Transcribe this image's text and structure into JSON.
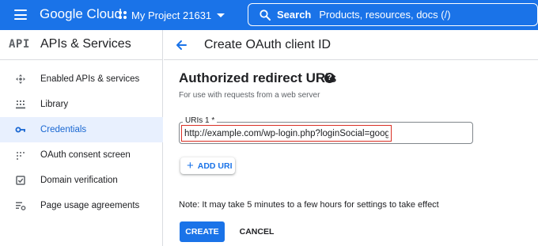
{
  "topbar": {
    "app_name": "Google Cloud",
    "project_name": "My Project 21631",
    "search_label": "Search",
    "search_placeholder": "Products, resources, docs (/)",
    "color": "#1a73e8"
  },
  "sidebar": {
    "badge": "API",
    "title": "APIs & Services",
    "items": [
      {
        "label": "Enabled APIs & services",
        "icon": "enabled-apis-icon",
        "active": false
      },
      {
        "label": "Library",
        "icon": "library-icon",
        "active": false
      },
      {
        "label": "Credentials",
        "icon": "key-icon",
        "active": true
      },
      {
        "label": "OAuth consent screen",
        "icon": "consent-screen-icon",
        "active": false
      },
      {
        "label": "Domain verification",
        "icon": "checkbox-icon",
        "active": false
      },
      {
        "label": "Page usage agreements",
        "icon": "settings-list-icon",
        "active": false
      }
    ]
  },
  "header": {
    "title": "Create OAuth client ID",
    "back_icon": "arrow-back-icon"
  },
  "section": {
    "title": "Authorized redirect URIs",
    "subtitle": "For use with requests from a web server",
    "help_icon": "help-icon"
  },
  "uri_field": {
    "label": "URIs 1 *",
    "value": "http://example.com/wp-login.php?loginSocial=google",
    "highlight_color": "#d93025"
  },
  "add_uri": {
    "label": "ADD URI"
  },
  "note": "Note: It may take 5 minutes to a few hours for settings to take effect",
  "actions": {
    "create_label": "CREATE",
    "cancel_label": "CANCEL"
  }
}
